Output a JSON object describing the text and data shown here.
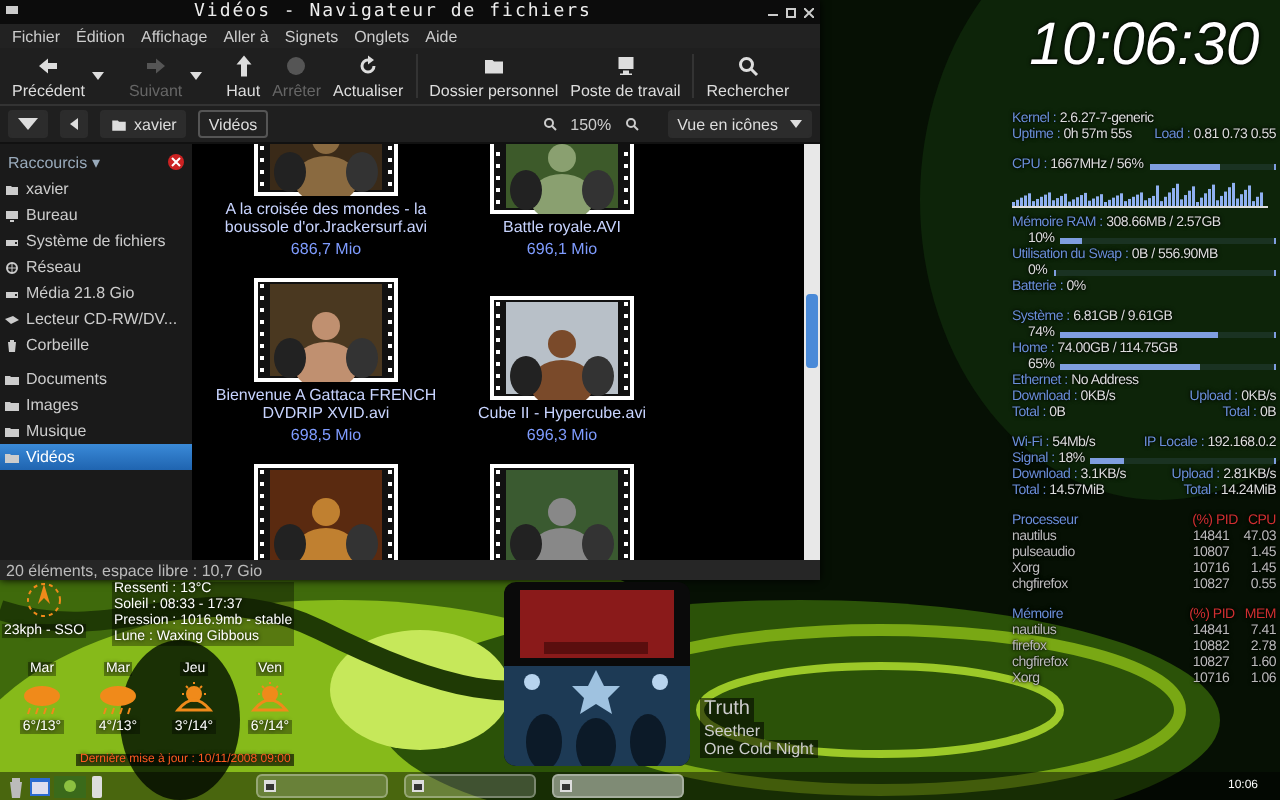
{
  "file_manager": {
    "title": "Vidéos - Navigateur de fichiers",
    "menu": [
      "Fichier",
      "Édition",
      "Affichage",
      "Aller à",
      "Signets",
      "Onglets",
      "Aide"
    ],
    "toolbar": [
      {
        "label": "Précédent",
        "kind": "back",
        "disabled": false,
        "has_menu": true
      },
      {
        "label": "Suivant",
        "kind": "forward",
        "disabled": true,
        "has_menu": true
      },
      {
        "label": "Haut",
        "kind": "up",
        "disabled": false,
        "has_menu": false
      },
      {
        "label": "Arrêter",
        "kind": "stop",
        "disabled": true,
        "has_menu": false
      },
      {
        "label": "Actualiser",
        "kind": "reload",
        "disabled": false,
        "has_menu": false
      },
      {
        "label": "Dossier personnel",
        "kind": "home",
        "disabled": false,
        "has_menu": false
      },
      {
        "label": "Poste de travail",
        "kind": "computer",
        "disabled": false,
        "has_menu": false
      },
      {
        "label": "Rechercher",
        "kind": "search",
        "disabled": false,
        "has_menu": false
      }
    ],
    "location": {
      "crumbs": [
        {
          "label": "xavier",
          "selected": false
        },
        {
          "label": "Vidéos",
          "selected": true
        }
      ],
      "zoom": "150%",
      "view": "Vue en icônes"
    },
    "sidebar": {
      "header": "Raccourcis ▾",
      "places": [
        {
          "label": "xavier",
          "kind": "home",
          "selected": false
        },
        {
          "label": "Bureau",
          "kind": "desktop",
          "selected": false
        },
        {
          "label": "Système de fichiers",
          "kind": "drive",
          "selected": false
        },
        {
          "label": "Réseau",
          "kind": "network",
          "selected": false
        },
        {
          "label": "Média 21.8 Gio",
          "kind": "drive",
          "selected": false
        },
        {
          "label": "Lecteur CD-RW/DV...",
          "kind": "optical",
          "selected": false
        },
        {
          "label": "Corbeille",
          "kind": "trash",
          "selected": false
        }
      ],
      "bookmarks": [
        {
          "label": "Documents",
          "kind": "folder",
          "selected": false
        },
        {
          "label": "Images",
          "kind": "folder",
          "selected": false
        },
        {
          "label": "Musique",
          "kind": "folder",
          "selected": false
        },
        {
          "label": "Vidéos",
          "kind": "folder",
          "selected": true
        }
      ]
    },
    "files": [
      {
        "kind": "video",
        "name": "A la croisée des mondes - la boussole d'or.Jrackersurf.avi",
        "size": "686,7 Mio"
      },
      {
        "kind": "video",
        "name": "Battle royale.AVI",
        "size": "696,1 Mio"
      },
      {
        "kind": "video",
        "name": "Bienvenue A Gattaca FRENCH DVDRIP XVID.avi",
        "size": "698,5 Mio"
      },
      {
        "kind": "video",
        "name": "Cube II - Hypercube.avi",
        "size": "696,3 Mio"
      },
      {
        "kind": "picture"
      },
      {
        "kind": "picture"
      }
    ],
    "status": "20 éléments, espace libre : 10,7 Gio"
  },
  "system_monitor": {
    "clock": "10:06:30",
    "sections": [
      [
        {
          "kind": "info",
          "label": "Kernel :",
          "value": "2.6.27-7-generic"
        },
        {
          "kind": "info",
          "label": "Uptime :",
          "value": "0h 57m 55s",
          "label2": "Load :",
          "value2": "0.81 0.73 0.55"
        }
      ],
      [
        {
          "kind": "info",
          "label": "CPU :",
          "value": "1667MHz / 56%",
          "level": 0.56
        },
        {
          "kind": "graph"
        },
        {
          "kind": "info",
          "label": "Mémoire RAM :",
          "value": "308.66MB / 2.57GB"
        },
        {
          "kind": "bar",
          "value": "10%",
          "level": 0.1
        },
        {
          "kind": "info",
          "label": "Utilisation du Swap :",
          "value": "0B / 556.90MB"
        },
        {
          "kind": "bar",
          "value": "0%",
          "level": 0
        },
        {
          "kind": "info",
          "label": "Batterie :",
          "value": "0%"
        }
      ],
      [
        {
          "kind": "info",
          "label": "Système :",
          "value": "6.81GB / 9.61GB"
        },
        {
          "kind": "bar",
          "value": "74%",
          "level": 0.74
        },
        {
          "kind": "info",
          "label": "Home :",
          "value": "74.00GB / 114.75GB"
        },
        {
          "kind": "bar",
          "value": "65%",
          "level": 0.65
        },
        {
          "kind": "info",
          "label": "Ethernet :",
          "value": "No Address"
        },
        {
          "kind": "info",
          "label": "Download :",
          "value": "0KB/s",
          "label2": "Upload :",
          "value2": "0KB/s"
        },
        {
          "kind": "info",
          "label": "Total :",
          "value": "0B",
          "label2": "Total :",
          "value2": "0B"
        }
      ],
      [
        {
          "kind": "info",
          "label": "Wi-Fi :",
          "value": "54Mb/s",
          "label2": "IP Locale :",
          "value2": "192.168.0.2"
        },
        {
          "kind": "info",
          "label": "Signal :",
          "value": "18%",
          "level": 0.18
        },
        {
          "kind": "info",
          "label": "Download :",
          "value": "3.1KB/s",
          "label2": "Upload :",
          "value2": "2.81KB/s"
        },
        {
          "kind": "info",
          "label": "Total :",
          "value": "14.57MiB",
          "label2": "Total :",
          "value2": "14.24MiB"
        }
      ],
      [
        {
          "kind": "head",
          "label": "Processeur",
          "value": "(%) PID   CPU"
        },
        {
          "kind": "proc",
          "name": "nautilus",
          "pid": "14841",
          "value": "47.03"
        },
        {
          "kind": "proc",
          "name": "pulseaudio",
          "pid": "10807",
          "value": "1.45"
        },
        {
          "kind": "proc",
          "name": "Xorg",
          "pid": "10716",
          "value": "1.45"
        },
        {
          "kind": "proc",
          "name": "chgfirefox",
          "pid": "10827",
          "value": "0.55"
        }
      ],
      [
        {
          "kind": "head",
          "label": "Mémoire",
          "value": "(%) PID   MEM"
        },
        {
          "kind": "proc",
          "name": "nautilus",
          "pid": "14841",
          "value": "7.41"
        },
        {
          "kind": "proc",
          "name": "firefox",
          "pid": "10882",
          "value": "2.78"
        },
        {
          "kind": "proc",
          "name": "chgfirefox",
          "pid": "10827",
          "value": "1.60"
        },
        {
          "kind": "proc",
          "name": "Xorg",
          "pid": "10716",
          "value": "1.06"
        }
      ]
    ]
  },
  "weather": {
    "wind": "23kph - SSO",
    "details": [
      "Ressenti : 13°C",
      "Soleil : 08:33 - 17:37",
      "Pression : 1016.9mb - stable",
      "Lune : Waxing Gibbous"
    ],
    "days": [
      {
        "day": "Mar",
        "temps": "6°/13°",
        "kind": "rain"
      },
      {
        "day": "Mar",
        "temps": "4°/13°",
        "kind": "rain"
      },
      {
        "day": "Jeu",
        "temps": "3°/14°",
        "kind": "partly"
      },
      {
        "day": "Ven",
        "temps": "6°/14°",
        "kind": "partly"
      }
    ],
    "updated": "Dernière mise à jour : 10/11/2008 09:00"
  },
  "player": {
    "title": "Truth",
    "artist": "Seether",
    "album": "One Cold Night"
  },
  "taskbar": {
    "tasks": [
      {
        "selected": false
      },
      {
        "selected": false
      },
      {
        "selected": true
      }
    ],
    "clock": "10:06"
  }
}
